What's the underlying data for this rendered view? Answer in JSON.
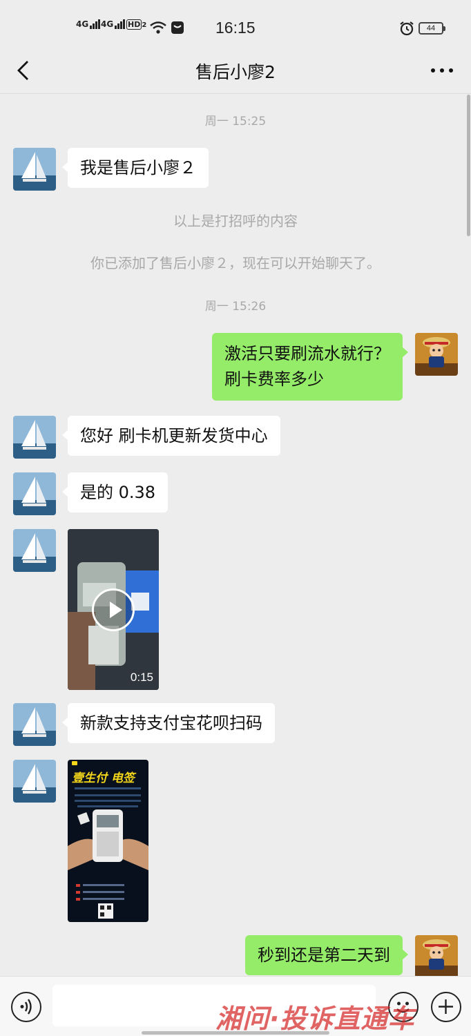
{
  "status_bar": {
    "signal1": "4G",
    "signal2": "4G",
    "hd_label": "HD",
    "hd_sub": "2",
    "time": "16:15",
    "battery": "44"
  },
  "header": {
    "title": "售后小廖2"
  },
  "messages": {
    "t1": "周一 15:25",
    "m1": "我是售后小廖２",
    "n1": "以上是打招呼的内容",
    "n2": "你已添加了售后小廖２，现在可以开始聊天了。",
    "t2": "周一 15:26",
    "m2_line1": "激活只要刷流水就行？",
    "m2_line2": "刷卡费率多少",
    "m3": "您好  刷卡机更新发货中心",
    "m4": "是的  0.38",
    "video_duration": "0:15",
    "m5": "新款支持支付宝花呗扫码",
    "poster_title": "壹生付  电签",
    "m6": "秒到还是第二天到"
  },
  "input_bar": {
    "watermark": "湘问·投诉直通车"
  },
  "colors": {
    "background": "#ededed",
    "own_bubble": "#95ec69",
    "other_bubble": "#ffffff",
    "system_text": "#a8a8a8"
  }
}
